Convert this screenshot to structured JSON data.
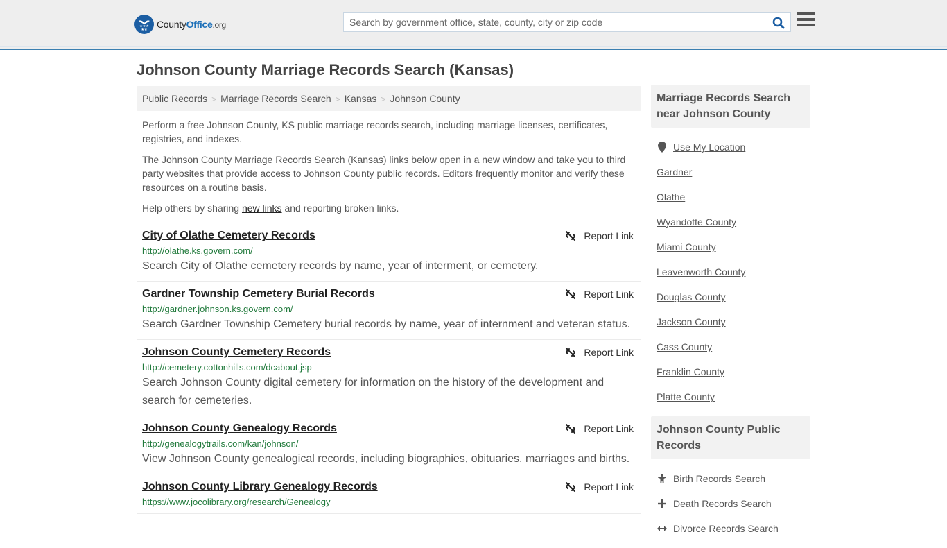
{
  "header": {
    "logo": {
      "brand_prefix": "County",
      "brand_main": "Office",
      "brand_suffix": ".org",
      "icon": "eagle-stars-badge-icon"
    },
    "search": {
      "placeholder": "Search by government office, state, county, city or zip code",
      "value": "",
      "icon": "search-icon"
    },
    "menu_icon": "hamburger-menu-icon"
  },
  "page": {
    "title": "Johnson County Marriage Records Search (Kansas)",
    "breadcrumb": [
      {
        "label": "Public Records"
      },
      {
        "label": "Marriage Records Search"
      },
      {
        "label": "Kansas"
      },
      {
        "label": "Johnson County"
      }
    ],
    "breadcrumb_separator": ">",
    "intro": {
      "p1": "Perform a free Johnson County, KS public marriage records search, including marriage licenses, certificates, registries, and indexes.",
      "p2": "The Johnson County Marriage Records Search (Kansas) links below open in a new window and take you to third party websites that provide access to Johnson County public records. Editors frequently monitor and verify these resources on a routine basis.",
      "p3_before": "Help others by sharing ",
      "p3_link": "new links",
      "p3_after": " and reporting broken links."
    }
  },
  "listings": [
    {
      "title": "City of Olathe Cemetery Records",
      "url": "http://olathe.ks.govern.com/",
      "description": "Search City of Olathe cemetery records by name, year of interment, or cemetery.",
      "report_label": "Report Link"
    },
    {
      "title": "Gardner Township Cemetery Burial Records",
      "url": "http://gardner.johnson.ks.govern.com/",
      "description": "Search Gardner Township Cemetery burial records by name, year of internment and veteran status.",
      "report_label": "Report Link"
    },
    {
      "title": "Johnson County Cemetery Records",
      "url": "http://cemetery.cottonhills.com/dcabout.jsp",
      "description": "Search Johnson County digital cemetery for information on the history of the development and search for cemeteries.",
      "report_label": "Report Link"
    },
    {
      "title": "Johnson County Genealogy Records",
      "url": "http://genealogytrails.com/kan/johnson/",
      "description": "View Johnson County genealogical records, including biographies, obituaries, marriages and births.",
      "report_label": "Report Link"
    },
    {
      "title": "Johnson County Library Genealogy Records",
      "url": "https://www.jocolibrary.org/research/Genealogy",
      "description": "",
      "report_label": "Report Link"
    }
  ],
  "sidebar": {
    "nearby": {
      "heading": "Marriage Records Search near Johnson County",
      "use_location": "Use My Location",
      "items": [
        "Gardner",
        "Olathe",
        "Wyandotte County",
        "Miami County",
        "Leavenworth County",
        "Douglas County",
        "Jackson County",
        "Cass County",
        "Franklin County",
        "Platte County"
      ]
    },
    "public_records": {
      "heading": "Johnson County Public Records",
      "items": [
        {
          "label": "Birth Records Search",
          "icon": "child-icon"
        },
        {
          "label": "Death Records Search",
          "icon": "cross-icon"
        },
        {
          "label": "Divorce Records Search",
          "icon": "arrows-horizontal-icon"
        }
      ]
    }
  },
  "colors": {
    "brand_blue": "#1c5ea3",
    "header_border": "#3a7fb0",
    "url_green": "#217a3c",
    "text": "#555555",
    "link_dark": "#222222"
  }
}
